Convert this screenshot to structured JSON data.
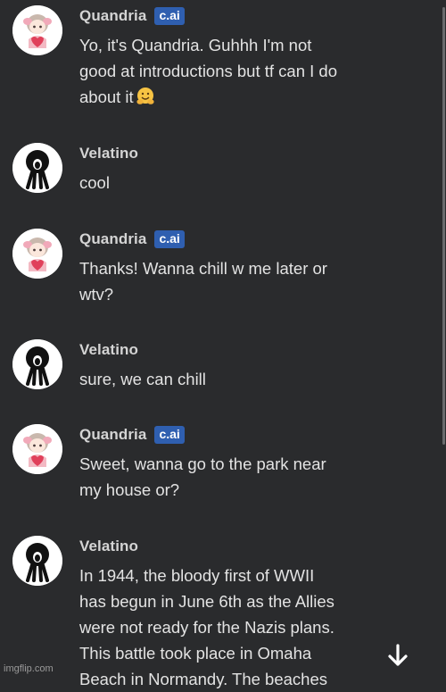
{
  "chat": {
    "ai_badge": "c.ai",
    "messages": [
      {
        "sender": "Quandria",
        "is_ai": true,
        "avatar": "anime-girl-avatar",
        "text": "Yo, it's Quandria. Guhhh I'm not\ngood at introductions but tf can I do\nabout it",
        "emoji": "hugging-face-emoji"
      },
      {
        "sender": "Velatino",
        "is_ai": false,
        "avatar": "screaming-figure-avatar",
        "text": "cool"
      },
      {
        "sender": "Quandria",
        "is_ai": true,
        "avatar": "anime-girl-avatar",
        "text": "Thanks! Wanna chill w me later or\nwtv?"
      },
      {
        "sender": "Velatino",
        "is_ai": false,
        "avatar": "screaming-figure-avatar",
        "text": "sure, we can chill"
      },
      {
        "sender": "Quandria",
        "is_ai": true,
        "avatar": "anime-girl-avatar",
        "text": "Sweet, wanna go to the park near\nmy house or?"
      },
      {
        "sender": "Velatino",
        "is_ai": false,
        "avatar": "screaming-figure-avatar",
        "text": "In 1944, the bloody first of WWII\nhas begun in June 6th as the Allies\nwere not ready for the Nazis plans.\nThis battle took place in Omaha\nBeach in Normandy. The beaches"
      }
    ]
  },
  "controls": {
    "scroll_down_icon": "arrow-down-icon"
  },
  "watermark": "imgflip.com"
}
